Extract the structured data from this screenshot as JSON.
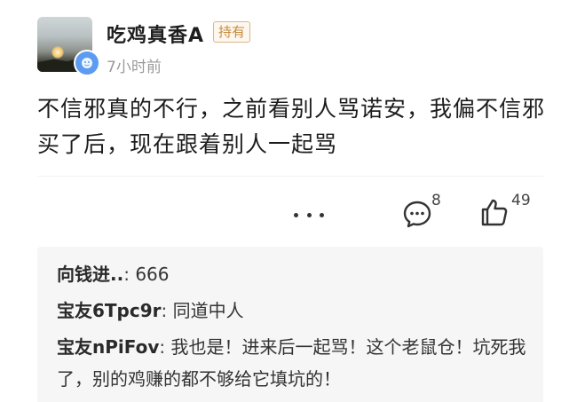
{
  "post": {
    "author": {
      "name": "吃鸡真香A",
      "tag": "持有",
      "avatar_icon": "sunset-landscape-avatar",
      "badge_icon": "fund-badge-icon"
    },
    "timestamp": "7小时前",
    "content": "不信邪真的不行，之前看别人骂诺安，我偏不信邪买了后，现在跟着别人一起骂",
    "actions": {
      "more_icon": "more-dots-icon",
      "comment_icon": "comment-bubble-icon",
      "comment_count": "8",
      "like_icon": "thumbs-up-icon",
      "like_count": "49"
    }
  },
  "replies": [
    {
      "author": "向钱进..",
      "separator": ":",
      "text": "666"
    },
    {
      "author": "宝友6Tpc9r",
      "separator": ":",
      "text": "同道中人"
    },
    {
      "author": "宝友nPiFov",
      "separator": ":",
      "text": "我也是！进来后一起骂！这个老鼠仓！坑死我了，别的鸡赚的都不够给它填坑的！"
    }
  ],
  "colors": {
    "tag_text": "#c48a3c",
    "tag_border": "#d8b88a",
    "badge_bg": "#5b9cf2",
    "reply_bg": "#f6f6f7",
    "timestamp": "#9a9a9a"
  }
}
